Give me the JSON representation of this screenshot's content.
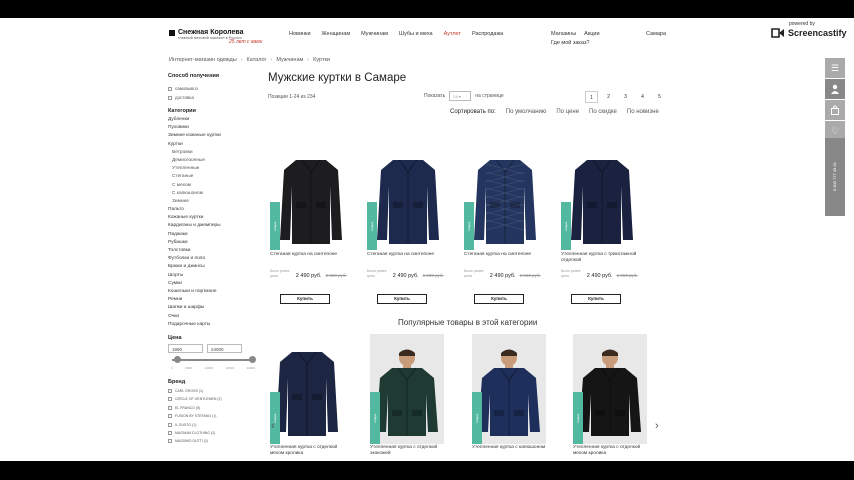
{
  "header": {
    "logo_name": "Снежная Королева",
    "logo_tagline": "главный меховой магазин в России",
    "logo_anniv": "25 лет с вами",
    "nav": [
      "Новинки",
      "Женщинам",
      "Мужчинам",
      "Шубы и меха",
      "Аутлет",
      "Распродажа"
    ],
    "nav_accent": "Аутлет",
    "right_links": [
      "Магазины",
      "Акции"
    ],
    "order_link": "Где мой заказ?",
    "city": "Самара"
  },
  "recorder_brand": {
    "powered_by": "powered by",
    "name": "Screencastify"
  },
  "breadcrumb": [
    "Интернет-магазин одежды",
    "Каталог",
    "Мужчинам",
    "Куртки"
  ],
  "sidebar": {
    "delivery_title": "Способ получения",
    "delivery_options": [
      "самовывоз",
      "доставка"
    ],
    "categories_title": "Категории",
    "categories": [
      {
        "label": "Дубленки",
        "sub": false
      },
      {
        "label": "Пуховики",
        "sub": false
      },
      {
        "label": "Зимние кожаные куртки",
        "sub": false
      },
      {
        "label": "Куртки",
        "sub": false
      },
      {
        "label": "Ветровки",
        "sub": true
      },
      {
        "label": "Демисезонные",
        "sub": true
      },
      {
        "label": "Утепленные",
        "sub": true
      },
      {
        "label": "Стеганые",
        "sub": true
      },
      {
        "label": "С мехом",
        "sub": true
      },
      {
        "label": "С капюшоном",
        "sub": true
      },
      {
        "label": "Зимние",
        "sub": true
      },
      {
        "label": "Пальто",
        "sub": false
      },
      {
        "label": "Кожаные куртки",
        "sub": false
      },
      {
        "label": "Кардиганы и джемперы",
        "sub": false
      },
      {
        "label": "Пиджаки",
        "sub": false
      },
      {
        "label": "Рубашки",
        "sub": false
      },
      {
        "label": "Толстовки",
        "sub": false
      },
      {
        "label": "Футболки и поло",
        "sub": false
      },
      {
        "label": "Брюки и джинсы",
        "sub": false
      },
      {
        "label": "Шорты",
        "sub": false
      },
      {
        "label": "Сумки",
        "sub": false
      },
      {
        "label": "Кошельки и портмоне",
        "sub": false
      },
      {
        "label": "Ремни",
        "sub": false
      },
      {
        "label": "Шапки и шарфы",
        "sub": false
      },
      {
        "label": "Очки",
        "sub": false
      },
      {
        "label": "Подарочные карты",
        "sub": false
      }
    ],
    "price_title": "Цена",
    "price_min": "1990",
    "price_max": "24000",
    "price_ticks": [
      "0",
      "6000",
      "12000",
      "18000",
      "24000"
    ],
    "brand_title": "Бренд",
    "brands": [
      "CARL GROSS (1)",
      "CIRCLE OF GENTLEMEN (2)",
      "EL FRANCO (5)",
      "FUSION BY STEFANO (1)",
      "IL GUSTO (1)",
      "MAGNUM CLOTHING (2)",
      "MASSIMO DUTTI (2)"
    ]
  },
  "main": {
    "title": "Мужские куртки в Самаре",
    "positions": "Позиции 1-24 из 234",
    "show_label": "Показать",
    "show_value": "24",
    "per_page": "на странице",
    "pages": [
      "1",
      "2",
      "3",
      "4",
      "5"
    ],
    "active_page": "1",
    "sort_label": "Сортировать по:",
    "sort_options": [
      "По умолчанию",
      "По цене",
      "По скидке",
      "По новизне"
    ]
  },
  "products": [
    {
      "name": "Стеганая куртка на синтепоне",
      "price_label": "цена",
      "price": "2 490 руб.",
      "old_price": "6 990 руб.",
      "was_label": "Было ранее",
      "badge": "скидка",
      "buy": "Купить",
      "color": "#1d1d1f",
      "quilted": false
    },
    {
      "name": "Стеганая куртка на синтепоне",
      "price_label": "цена",
      "price": "2 490 руб.",
      "old_price": "6 990 руб.",
      "was_label": "Было ранее",
      "badge": "скидка",
      "buy": "Купить",
      "color": "#1e2a4d",
      "quilted": false
    },
    {
      "name": "Стеганая куртка на синтепоне",
      "price_label": "цена",
      "price": "2 490 руб.",
      "old_price": "6 990 руб.",
      "was_label": "Было ранее",
      "badge": "скидка",
      "buy": "Купить",
      "color": "#24365f",
      "quilted": true
    },
    {
      "name": "Утепленная куртка с трикотажной отделкой",
      "price_label": "цена",
      "price": "2 490 руб.",
      "old_price": "6 990 руб.",
      "was_label": "Было ранее",
      "badge": "скидка",
      "buy": "Купить",
      "color": "#1a2240",
      "quilted": false
    }
  ],
  "popular_title": "Популярные товары в этой категории",
  "popular": [
    {
      "name": "Утепленная куртка с отделкой мехом кролика",
      "badge": "скидка",
      "color": "#1c2541",
      "photo": false
    },
    {
      "name": "Утепленная куртка с отделкой экокожей",
      "badge": "скидка",
      "color": "#1f3a33",
      "photo": true
    },
    {
      "name": "Утепленная куртка с капюшоном",
      "badge": "скидка",
      "color": "#1f2f5c",
      "photo": true
    },
    {
      "name": "Утепленная куртка с отделкой мехом кролика",
      "badge": "скидка",
      "color": "#151515",
      "photo": true
    }
  ],
  "side_phone": "8 800 777 49 81",
  "colors": {
    "accent": "#c0392b",
    "badge": "#52b9a0"
  }
}
